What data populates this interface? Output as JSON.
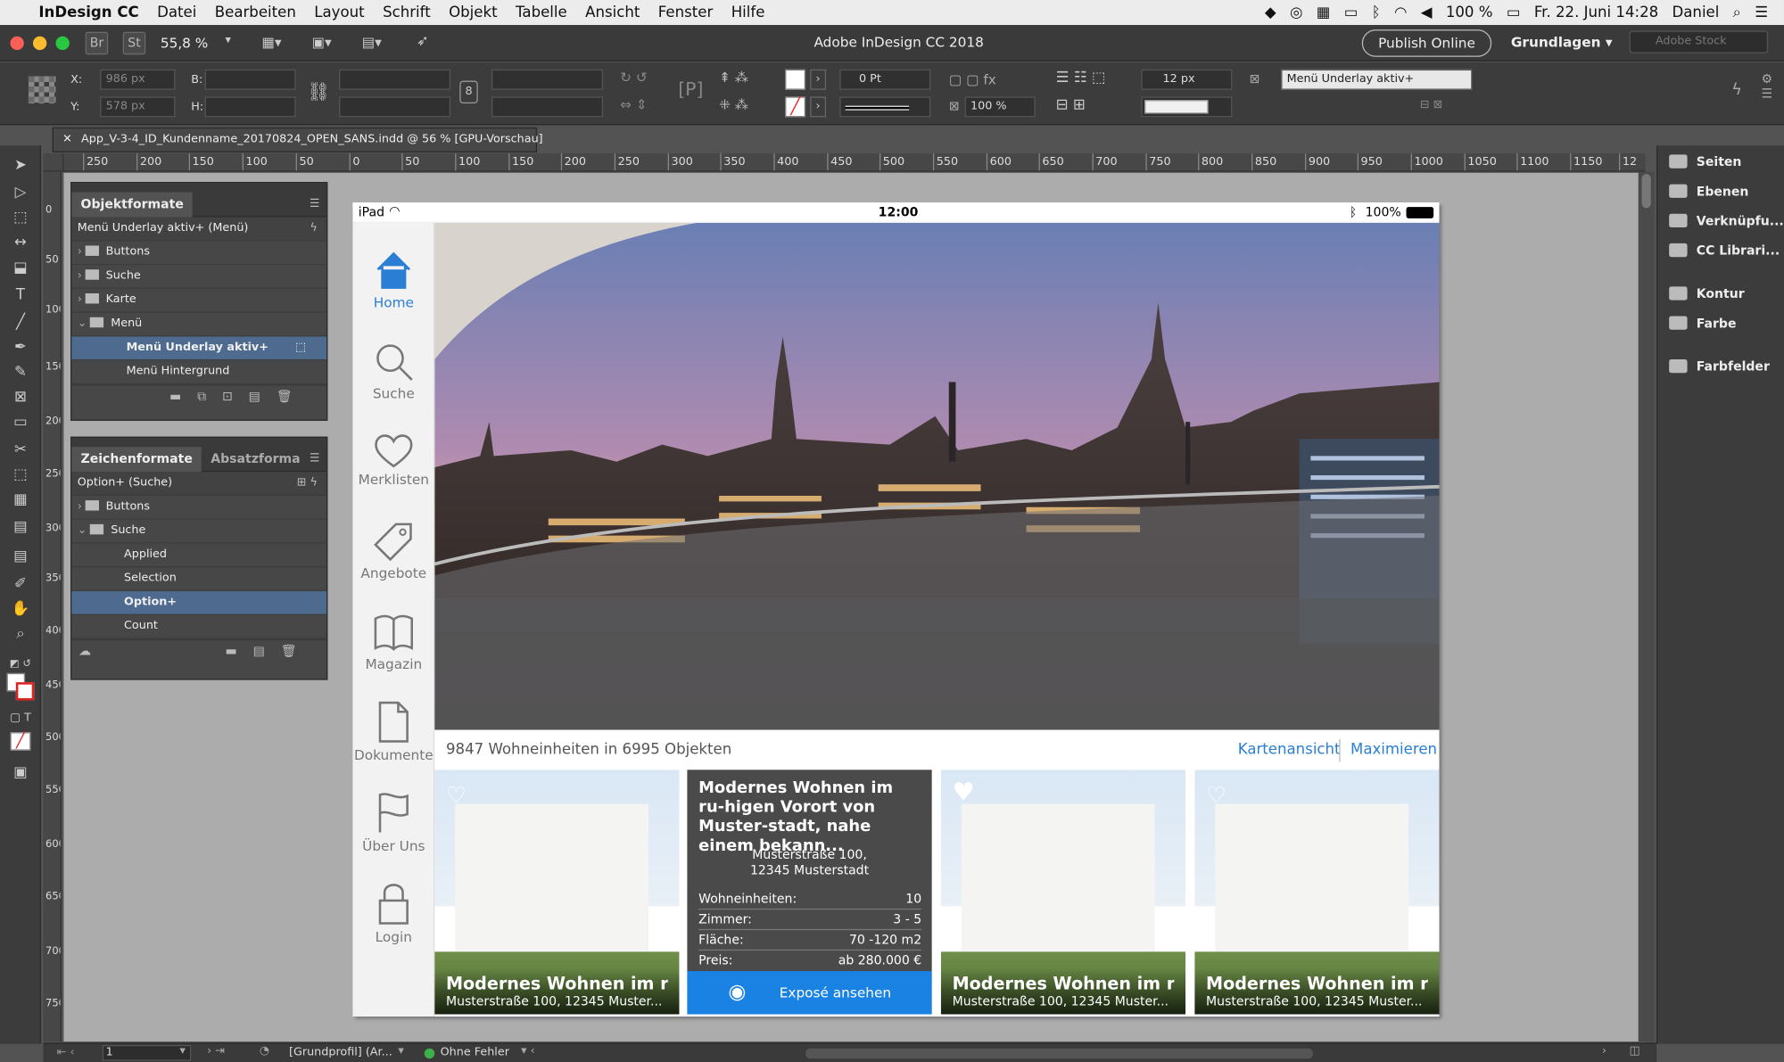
{
  "menubar": {
    "app": "InDesign CC",
    "items": [
      "Datei",
      "Bearbeiten",
      "Layout",
      "Schrift",
      "Objekt",
      "Tabelle",
      "Ansicht",
      "Fenster",
      "Hilfe"
    ],
    "battery": "100 %",
    "datetime": "Fr. 22. Juni  14:28",
    "user": "Daniel"
  },
  "titlebar": {
    "zoom": "55,8 %",
    "title": "Adobe InDesign CC 2018",
    "publish": "Publish Online",
    "workspace": "Grundlagen",
    "stock_placeholder": "Adobe Stock",
    "br": "Br",
    "st": "St"
  },
  "control": {
    "x_label": "X:",
    "x_value": "986 px",
    "y_label": "Y:",
    "y_value": "578 px",
    "b_label": "B:",
    "h_label": "H:",
    "stroke_weight": "0 Pt",
    "opacity": "100 %",
    "spacing": "12 px",
    "object_style": "Menü Underlay aktiv+"
  },
  "document_tab": "App_V-3-4_ID_Kundenname_20170824_OPEN_SANS.indd @ 56 % [GPU-Vorschau]",
  "ruler": {
    "h_ticks": [
      "250",
      "200",
      "150",
      "100",
      "50",
      "0",
      "50",
      "100",
      "150",
      "200",
      "250",
      "300",
      "350",
      "400",
      "450",
      "500",
      "550",
      "600",
      "650",
      "700",
      "750",
      "800",
      "850",
      "900",
      "950",
      "1000",
      "1050",
      "1100",
      "1150",
      "12"
    ],
    "v_ticks": [
      "0",
      "50",
      "100",
      "150",
      "200",
      "250",
      "300",
      "350",
      "400",
      "450",
      "500",
      "550",
      "600",
      "650",
      "700",
      "750"
    ]
  },
  "panel_objekt": {
    "tab_active": "Objektformate",
    "current": "Menü Underlay aktiv+ (Menü)",
    "rows": [
      {
        "label": "Buttons",
        "type": "folder",
        "open": false
      },
      {
        "label": "Suche",
        "type": "folder",
        "open": false
      },
      {
        "label": "Karte",
        "type": "folder",
        "open": false
      },
      {
        "label": "Menü",
        "type": "folder",
        "open": true
      },
      {
        "label": "Menü Underlay aktiv+",
        "type": "style",
        "selected": true
      },
      {
        "label": "Menü Hintergrund",
        "type": "style",
        "selected": false
      }
    ]
  },
  "panel_zeichen": {
    "tab_active": "Zeichenformate",
    "tab_other": "Absatzforma",
    "current": "Option+ (Suche)",
    "rows": [
      {
        "label": "Buttons",
        "type": "folder",
        "open": false
      },
      {
        "label": "Suche",
        "type": "folder",
        "open": true
      },
      {
        "label": "Applied",
        "type": "style",
        "selected": false
      },
      {
        "label": "Selection",
        "type": "style",
        "selected": false
      },
      {
        "label": "Option+",
        "type": "style",
        "selected": true
      },
      {
        "label": "Count",
        "type": "style",
        "selected": false
      }
    ]
  },
  "dock": [
    "Seiten",
    "Ebenen",
    "Verknüpfu...",
    "CC Librari...",
    "Kontur",
    "Farbe",
    "Farbfelder"
  ],
  "ipad": {
    "device": "iPad",
    "time": "12:00",
    "battery": "100%",
    "nav": [
      {
        "label": "Home",
        "icon": "home-icon",
        "active": true
      },
      {
        "label": "Suche",
        "icon": "search-icon",
        "active": false
      },
      {
        "label": "Merklisten",
        "icon": "heart-icon",
        "active": false
      },
      {
        "label": "Angebote",
        "icon": "tag-icon",
        "active": false
      },
      {
        "label": "Magazin",
        "icon": "book-icon",
        "active": false
      },
      {
        "label": "Dokumente",
        "icon": "document-icon",
        "active": false
      },
      {
        "label": "Über Uns",
        "icon": "flag-icon",
        "active": false
      },
      {
        "label": "Login",
        "icon": "lock-icon",
        "active": false
      }
    ],
    "summary": "9847 Wohneinheiten in 6995 Objekten",
    "link_map": "Kartenansicht",
    "link_max": "Maximieren",
    "cards": [
      {
        "title": "Modernes Wohnen im ruh...",
        "sub": "Musterstraße 100, 12345 Muster..."
      },
      {
        "title": "Modernes Wohnen im ruh...",
        "sub": "Musterstraße 100, 12345 Muster..."
      },
      {
        "title": "Modernes Wohnen im ruh...",
        "sub": "Musterstraße 100, 12345 Muster..."
      }
    ],
    "detail": {
      "title": "Modernes Wohnen im ru-higen Vorort von Muster-stadt, nahe einem bekann...",
      "address1": "Musterstraße 100,",
      "address2": "12345 Musterstadt",
      "rows": [
        {
          "k": "Wohneinheiten:",
          "v": "10"
        },
        {
          "k": "Zimmer:",
          "v": "3 - 5"
        },
        {
          "k": "Fläche:",
          "v": "70 -120 m2"
        },
        {
          "k": "Preis:",
          "v": "ab 280.000 €"
        }
      ],
      "button": "Exposé ansehen"
    }
  },
  "bottom": {
    "page": "1",
    "profile": "[Grundprofil] (Ar...",
    "errors": "Ohne Fehler"
  },
  "colors": {
    "accent_blue": "#2a7fd5",
    "selection": "#4e6b8f",
    "expose_button": "#1a82e2"
  }
}
